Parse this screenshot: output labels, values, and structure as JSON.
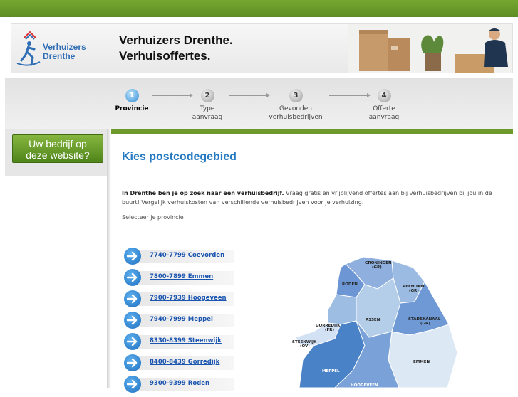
{
  "header": {
    "logo_line1": "Verhuizers",
    "logo_line2": "Drenthe",
    "tagline_line1": "Verhuizers Drenthe.",
    "tagline_line2": "Verhuisoffertes."
  },
  "steps": [
    {
      "number": "1",
      "label_line1": "Provincie",
      "label_line2": ""
    },
    {
      "number": "2",
      "label_line1": "Type",
      "label_line2": "aanvraag"
    },
    {
      "number": "3",
      "label_line1": "Gevonden",
      "label_line2": "verhuisbedrijven"
    },
    {
      "number": "4",
      "label_line1": "Offerte",
      "label_line2": "aanvraag"
    }
  ],
  "sidebar": {
    "button_line1": "Uw bedrijf op",
    "button_line2": "deze website?"
  },
  "main": {
    "title": "Kies postcodegebied",
    "intro_bold": "In Drenthe ben je op zoek naar een verhuisbedrijf.",
    "intro_rest": " Vraag gratis en vrijblijvend offertes aan bij verhuisbedrijven bij jou in de buurt! Vergelijk verhuiskosten van verschillende verhuisbedrijven voor je verhuizing.",
    "select_label": "Selecteer je provincie"
  },
  "postcodes": [
    "7740-7799 Coevorden",
    "7800-7899 Emmen",
    "7900-7939 Hoogeveen",
    "7940-7999 Meppel",
    "8330-8399 Steenwijk",
    "8400-8439 Gorredijk",
    "9300-9399 Roden"
  ],
  "map_labels": {
    "groningen": "GRONINGEN",
    "groningen_sub": "(GR)",
    "roden": "RODEN",
    "veendam": "VEENDAM",
    "veendam_sub": "(GR)",
    "assen": "ASSEN",
    "stadskanaal": "STADSKANAAL",
    "stadskanaal_sub": "(GR)",
    "gorredijk": "GORREDIJK",
    "gorredijk_sub": "(FR)",
    "steenwijk": "STEENWIJK",
    "steenwijk_sub": "(OV)",
    "emmen": "EMMEN",
    "meppel": "MEPPEL",
    "hoogeveen": "HOOGEVEEN"
  },
  "colors": {
    "topbar": "#6a9a2a",
    "accent_blue": "#2579c1",
    "link_blue": "#1a55b0",
    "button_green": "#5f922a"
  }
}
